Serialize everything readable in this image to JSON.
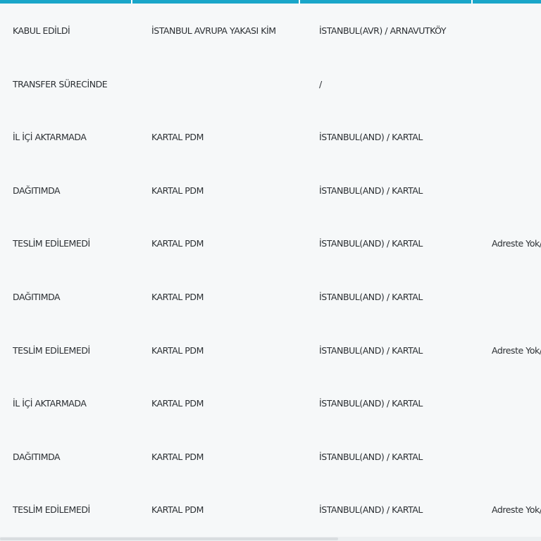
{
  "colors": {
    "header_accent": "#1aa6c9",
    "background": "#f6f8f9",
    "text": "#2b2f33"
  },
  "table": {
    "rows": [
      {
        "status": "KABUL EDİLDİ",
        "unit": "İSTANBUL AVRUPA YAKASI KİM",
        "location": "İSTANBUL(AVR) / ARNAVUTKÖY",
        "description": ""
      },
      {
        "status": "TRANSFER SÜRECİNDE",
        "unit": "",
        "location": "/",
        "description": ""
      },
      {
        "status": "İL İÇİ AKTARMADA",
        "unit": "KARTAL PDM",
        "location": "İSTANBUL(AND) / KARTAL",
        "description": ""
      },
      {
        "status": "DAĞITIMDA",
        "unit": "KARTAL PDM",
        "location": "İSTANBUL(AND) / KARTAL",
        "description": ""
      },
      {
        "status": "TESLİM EDİLEMEDİ",
        "unit": "KARTAL PDM",
        "location": "İSTANBUL(AND) / KARTAL",
        "description": "Adreste Yok/"
      },
      {
        "status": "DAĞITIMDA",
        "unit": "KARTAL PDM",
        "location": "İSTANBUL(AND) / KARTAL",
        "description": ""
      },
      {
        "status": "TESLİM EDİLEMEDİ",
        "unit": "KARTAL PDM",
        "location": "İSTANBUL(AND) / KARTAL",
        "description": "Adreste Yok/"
      },
      {
        "status": "İL İÇİ AKTARMADA",
        "unit": "KARTAL PDM",
        "location": "İSTANBUL(AND) / KARTAL",
        "description": ""
      },
      {
        "status": "DAĞITIMDA",
        "unit": "KARTAL PDM",
        "location": "İSTANBUL(AND) / KARTAL",
        "description": ""
      },
      {
        "status": "TESLİM EDİLEMEDİ",
        "unit": "KARTAL PDM",
        "location": "İSTANBUL(AND) / KARTAL",
        "description": "Adreste Yok/"
      }
    ]
  }
}
